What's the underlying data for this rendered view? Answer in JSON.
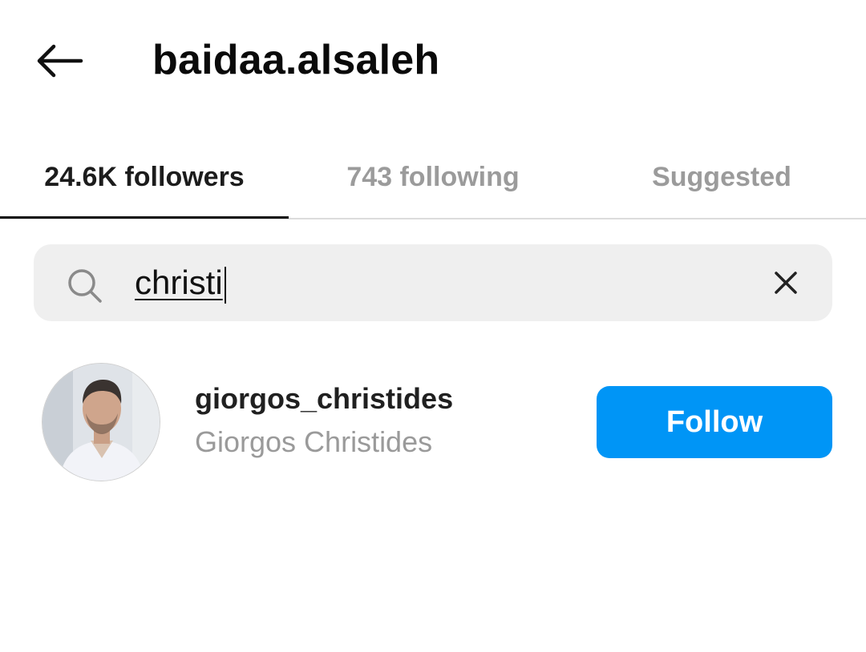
{
  "header": {
    "back_icon": "arrow-left-icon",
    "title": "baidaa.alsaleh"
  },
  "tabs": [
    {
      "label": "24.6K followers",
      "active": true
    },
    {
      "label": "743 following",
      "active": false
    },
    {
      "label": "Suggested",
      "active": false
    }
  ],
  "search": {
    "icon": "search-icon",
    "value": "christi",
    "clear_icon": "close-icon"
  },
  "results": [
    {
      "username": "giorgos_christides",
      "full_name": "Giorgos Christides",
      "action_label": "Follow"
    }
  ],
  "colors": {
    "accent": "#0095f6",
    "search_bg": "#efefef",
    "muted_text": "#9a9a9a"
  }
}
